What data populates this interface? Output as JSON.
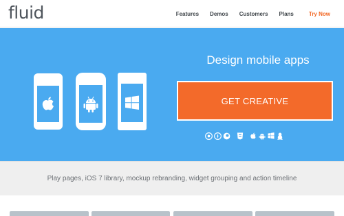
{
  "header": {
    "logo": "fluid",
    "nav": [
      {
        "label": "Features"
      },
      {
        "label": "Demos"
      },
      {
        "label": "Customers"
      },
      {
        "label": "Plans"
      }
    ],
    "cta": "Try Now"
  },
  "hero": {
    "title": "Design mobile apps",
    "cta_label": "GET CREATIVE",
    "devices": [
      "apple-icon",
      "android-icon",
      "windows-icon"
    ],
    "platform_icons": [
      "chrome-icon",
      "safari-icon",
      "firefox-icon",
      "html5-icon",
      "apple-icon",
      "android-icon",
      "windows-icon",
      "linux-icon"
    ]
  },
  "subbar": {
    "text": "Play pages, iOS 7 library, mockup rebranding, widget grouping and action timeline"
  },
  "colors": {
    "hero_bg": "#4aaaf0",
    "cta_bg": "#f36a2a",
    "nav_cta": "#f26622"
  }
}
